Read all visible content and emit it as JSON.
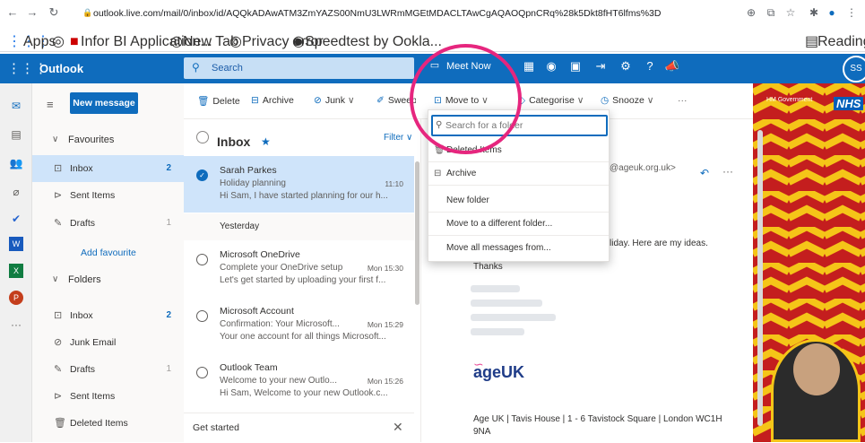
{
  "browser": {
    "url": "outlook.live.com/mail/0/inbox/id/AQQkADAwATM3ZmYAZS00NmU3LWRmMGEtMDACLTAwCgAQAOQpnCRq%28k5Dkt8fHT6lfms%3D",
    "bookmarks": [
      "Apps",
      "Infor BI Application...",
      "New Tab",
      "Privacy error",
      "Speedtest by Ookla..."
    ],
    "reading_list": "Reading list"
  },
  "header": {
    "brand": "Outlook",
    "search_placeholder": "Search",
    "meet_now": "Meet Now",
    "avatar_initials": "SS"
  },
  "folders": {
    "new_message": "New message",
    "favourites_label": "Favourites",
    "favourites": [
      {
        "label": "Inbox",
        "count": "2"
      },
      {
        "label": "Sent Items",
        "count": ""
      },
      {
        "label": "Drafts",
        "count": "1"
      }
    ],
    "add_favourite": "Add favourite",
    "folders_label": "Folders",
    "folders": [
      {
        "label": "Inbox",
        "count": "2"
      },
      {
        "label": "Junk Email",
        "count": ""
      },
      {
        "label": "Drafts",
        "count": "1"
      },
      {
        "label": "Sent Items",
        "count": ""
      },
      {
        "label": "Deleted Items",
        "count": ""
      }
    ]
  },
  "toolbar": {
    "delete": "Delete",
    "archive": "Archive",
    "junk": "Junk",
    "sweep": "Sweep",
    "move_to": "Move to",
    "categorise": "Categorise",
    "snooze": "Snooze",
    "more": "···"
  },
  "message_list": {
    "title": "Inbox",
    "filter": "Filter",
    "yesterday_label": "Yesterday",
    "get_started": "Get started",
    "messages": [
      {
        "sender": "Sarah Parkes",
        "subject": "Holiday planning",
        "time": "11:10",
        "preview": "Hi Sam, I have started planning for our h..."
      },
      {
        "sender": "Microsoft OneDrive",
        "subject": "Complete your OneDrive setup",
        "time": "Mon 15:30",
        "preview": "Let's get started by uploading your first f..."
      },
      {
        "sender": "Microsoft Account",
        "subject": "Confirmation: Your Microsoft...",
        "time": "Mon 15:29",
        "preview": "Your one account for all things Microsoft..."
      },
      {
        "sender": "Outlook Team",
        "subject": "Welcome to your new Outlo...",
        "time": "Mon 15:26",
        "preview": "Hi Sam, Welcome to your new Outlook.c..."
      }
    ]
  },
  "reading_pane": {
    "from_fragment": "@ageuk.org.uk>",
    "body_fragment": "liday. Here are my ideas.",
    "thanks": "Thanks",
    "logo_text": "ageUK",
    "footer": "Age UK | Tavis House | 1 - 6 Tavistock Square | London WC1H",
    "footer2": "9NA"
  },
  "move_dropdown": {
    "search_placeholder": "Search for a folder",
    "items": [
      "Deleted Items",
      "Archive",
      "New folder",
      "Move to a different folder...",
      "Move all messages from..."
    ]
  },
  "ad": {
    "nhs": "NHS",
    "gov": "HM Government"
  },
  "colors": {
    "brand": "#0f6cbd",
    "highlight": "#e6267e",
    "selected": "#cfe4fa"
  }
}
